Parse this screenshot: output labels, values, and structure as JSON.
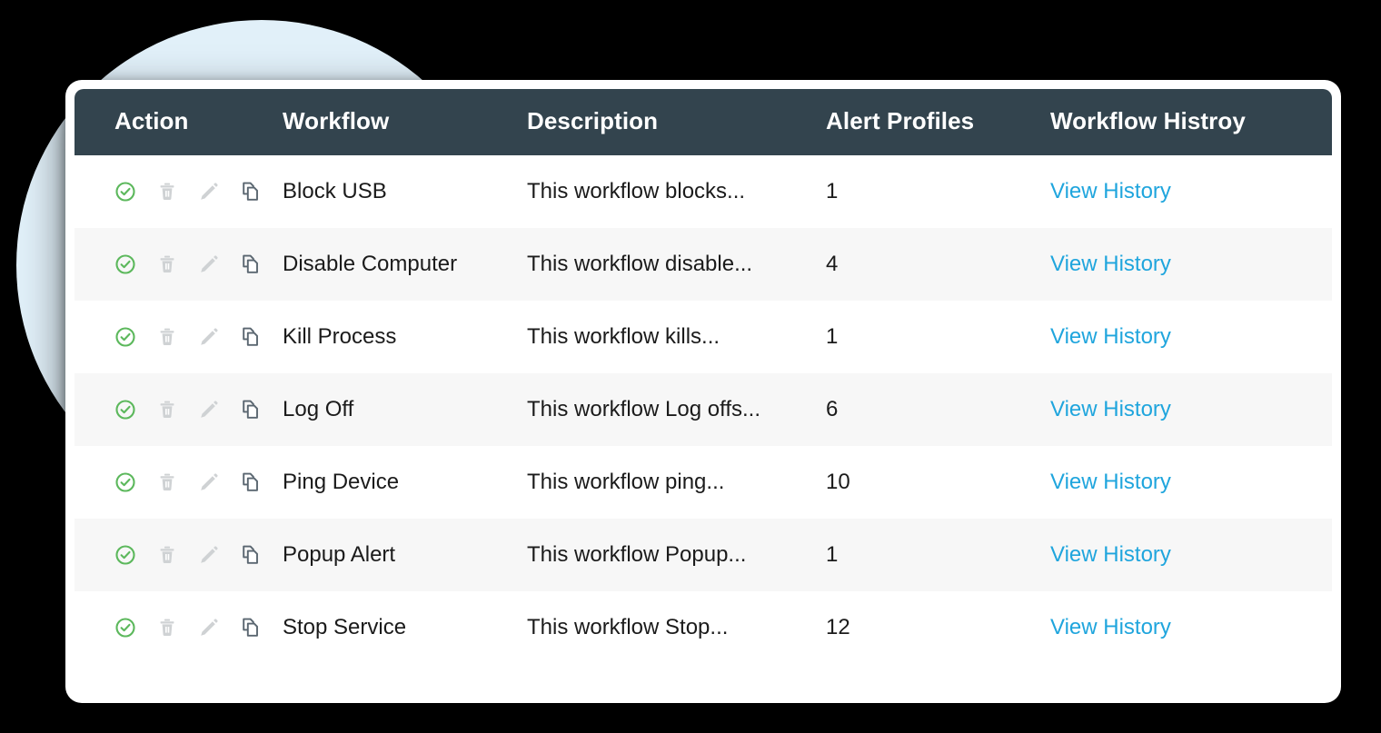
{
  "theme": {
    "page_background": "#000000",
    "decor_circle_color": "#e1f0f9",
    "card_background": "#ffffff",
    "header_background": "#33444e",
    "header_text_color": "#ffffff",
    "row_alt_background": "#f7f7f7",
    "link_color": "#1fa5dd",
    "enable_icon_color": "#5cb85c",
    "muted_icon_color": "#cfd2d4",
    "copy_icon_color": "#5a6670"
  },
  "table": {
    "columns": [
      {
        "key": "action",
        "label": "Action"
      },
      {
        "key": "workflow",
        "label": "Workflow"
      },
      {
        "key": "description",
        "label": "Description"
      },
      {
        "key": "alert_profiles",
        "label": "Alert Profiles"
      },
      {
        "key": "history",
        "label": "Workflow Histroy"
      }
    ],
    "action_icons": [
      {
        "name": "enable-icon",
        "glyph": "check-circle",
        "state": "active"
      },
      {
        "name": "delete-icon",
        "glyph": "trash",
        "state": "muted"
      },
      {
        "name": "edit-icon",
        "glyph": "pencil",
        "state": "muted"
      },
      {
        "name": "duplicate-icon",
        "glyph": "copy",
        "state": "normal"
      }
    ],
    "history_link_label": "View History",
    "rows": [
      {
        "workflow": "Block USB",
        "description": "This workflow blocks...",
        "alert_profiles": "1"
      },
      {
        "workflow": "Disable Computer",
        "description": "This workflow disable...",
        "alert_profiles": "4"
      },
      {
        "workflow": "Kill Process",
        "description": "This workflow kills...",
        "alert_profiles": "1"
      },
      {
        "workflow": "Log Off",
        "description": "This workflow Log offs...",
        "alert_profiles": "6"
      },
      {
        "workflow": "Ping Device",
        "description": "This workflow ping...",
        "alert_profiles": "10"
      },
      {
        "workflow": "Popup Alert",
        "description": "This workflow Popup...",
        "alert_profiles": "1"
      },
      {
        "workflow": "Stop Service",
        "description": "This workflow Stop...",
        "alert_profiles": "12"
      }
    ]
  }
}
